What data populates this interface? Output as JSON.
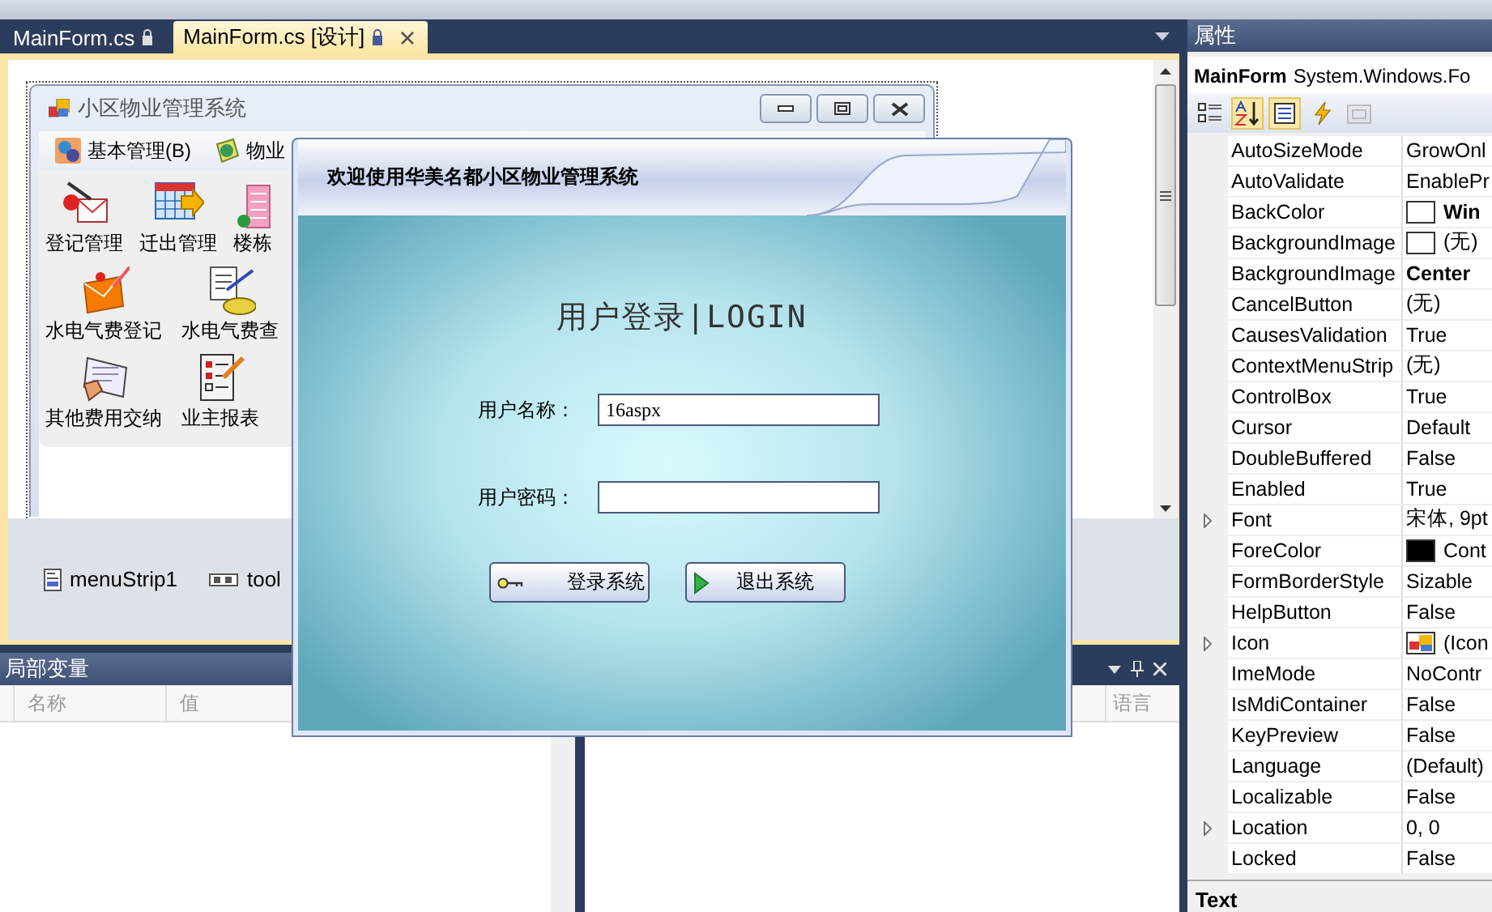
{
  "doc_tabs": [
    {
      "label": "MainForm.cs",
      "selected": false,
      "read_only": true,
      "closable": false
    },
    {
      "label": "MainForm.cs [设计]",
      "selected": true,
      "read_only": true,
      "closable": true
    }
  ],
  "designer": {
    "form_title": "小区物业管理系统",
    "menu": [
      "基本管理(B)",
      "物业"
    ],
    "tool_rows": [
      [
        "登记管理",
        "迁出管理",
        "楼栋"
      ],
      [
        "水电气费登记",
        "水电气费查"
      ],
      [
        "其他费用交纳",
        "业主报表"
      ]
    ],
    "tray": [
      "menuStrip1",
      "tool"
    ]
  },
  "locals_panel": {
    "title": "局部变量",
    "columns": [
      "名称",
      "值"
    ]
  },
  "output_panel": {
    "columns": [
      "语言"
    ]
  },
  "properties": {
    "title": "属性",
    "object_name": "MainForm",
    "object_type": "System.Windows.Fo",
    "toolbar": [
      {
        "selected": false,
        "disabled": false
      },
      {
        "selected": true,
        "disabled": false
      },
      {
        "selected": true,
        "disabled": false
      },
      {
        "selected": false,
        "disabled": false
      },
      {
        "selected": false,
        "disabled": true
      }
    ],
    "rows": [
      {
        "name": "AutoSizeMode",
        "value": "GrowOnl",
        "kind": "text",
        "bold": false,
        "expandable": false
      },
      {
        "name": "AutoValidate",
        "value": "EnablePr",
        "kind": "text",
        "bold": false,
        "expandable": false
      },
      {
        "name": "BackColor",
        "value": "Win",
        "kind": "color",
        "color": "#ffffff",
        "bold": true,
        "expandable": false
      },
      {
        "name": "BackgroundImage",
        "value": "(无)",
        "kind": "image",
        "bold": false,
        "expandable": false
      },
      {
        "name": "BackgroundImage",
        "value": "Center",
        "kind": "text",
        "bold": true,
        "expandable": false
      },
      {
        "name": "CancelButton",
        "value": "(无)",
        "kind": "text",
        "bold": false,
        "expandable": false
      },
      {
        "name": "CausesValidation",
        "value": "True",
        "kind": "text",
        "bold": false,
        "expandable": false
      },
      {
        "name": "ContextMenuStrip",
        "value": "(无)",
        "kind": "text",
        "bold": false,
        "expandable": false
      },
      {
        "name": "ControlBox",
        "value": "True",
        "kind": "text",
        "bold": false,
        "expandable": false
      },
      {
        "name": "Cursor",
        "value": "Default",
        "kind": "text",
        "bold": false,
        "expandable": false
      },
      {
        "name": "DoubleBuffered",
        "value": "False",
        "kind": "text",
        "bold": false,
        "expandable": false
      },
      {
        "name": "Enabled",
        "value": "True",
        "kind": "text",
        "bold": false,
        "expandable": false
      },
      {
        "name": "Font",
        "value": "宋体, 9pt",
        "kind": "text",
        "bold": false,
        "expandable": true
      },
      {
        "name": "ForeColor",
        "value": "Cont",
        "kind": "color",
        "color": "#000000",
        "bold": false,
        "expandable": false
      },
      {
        "name": "FormBorderStyle",
        "value": "Sizable",
        "kind": "text",
        "bold": false,
        "expandable": false
      },
      {
        "name": "HelpButton",
        "value": "False",
        "kind": "text",
        "bold": false,
        "expandable": false
      },
      {
        "name": "Icon",
        "value": "(Icon",
        "kind": "icon",
        "bold": false,
        "expandable": true
      },
      {
        "name": "ImeMode",
        "value": "NoContr",
        "kind": "text",
        "bold": false,
        "expandable": false
      },
      {
        "name": "IsMdiContainer",
        "value": "False",
        "kind": "text",
        "bold": false,
        "expandable": false
      },
      {
        "name": "KeyPreview",
        "value": "False",
        "kind": "text",
        "bold": false,
        "expandable": false
      },
      {
        "name": "Language",
        "value": "(Default)",
        "kind": "text",
        "bold": false,
        "expandable": false
      },
      {
        "name": "Localizable",
        "value": "False",
        "kind": "text",
        "bold": false,
        "expandable": false
      },
      {
        "name": "Location",
        "value": "0, 0",
        "kind": "text",
        "bold": false,
        "expandable": true
      },
      {
        "name": "Locked",
        "value": "False",
        "kind": "text",
        "bold": false,
        "expandable": false
      }
    ],
    "description_title": "Text"
  },
  "login_dialog": {
    "banner": "欢迎使用华美名都小区物业管理系统",
    "heading": "用户登录|LOGIN",
    "fields": [
      {
        "label": "用户名称：",
        "value": "16aspx"
      },
      {
        "label": "用户密码："
      }
    ],
    "buttons": [
      {
        "label": "登录系统",
        "kind": "key"
      },
      {
        "label": "退出系统",
        "kind": "play"
      }
    ]
  }
}
